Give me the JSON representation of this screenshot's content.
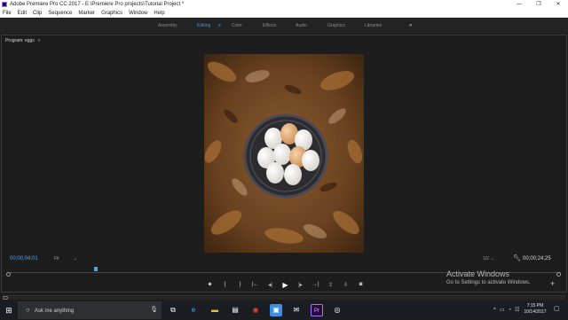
{
  "window": {
    "title": "Adobe Premiere Pro CC 2017 - E:\\Premiere Pro projects\\Tutorial Project *",
    "controls": [
      "—",
      "❐",
      "✕"
    ]
  },
  "menu": [
    "File",
    "Edit",
    "Clip",
    "Sequence",
    "Marker",
    "Graphics",
    "Window",
    "Help"
  ],
  "workspaces": [
    {
      "label": "Assembly",
      "active": false
    },
    {
      "label": "Editing",
      "active": true
    },
    {
      "label": "Color",
      "active": false
    },
    {
      "label": "Effects",
      "active": false
    },
    {
      "label": "Audio",
      "active": false
    },
    {
      "label": "Graphics",
      "active": false
    },
    {
      "label": "Libraries",
      "active": false
    }
  ],
  "workspace_menu_glyph": "≡",
  "more_glyph": "»",
  "program_monitor": {
    "tab_label": "Program: eggs",
    "tab_menu": "≡",
    "timecode_current": "00;00;04;01",
    "timecode_duration": "00;00;24;25",
    "zoom": "Fit",
    "resolution": "1/2",
    "caret": "⌄",
    "playhead_fraction": 0.16
  },
  "transport": {
    "marker": "⬥",
    "mark_in": "{",
    "mark_out": "}",
    "go_to_in": "|←",
    "step_back": "◂|",
    "play": "▶",
    "step_forward": "|▸",
    "go_to_out": "→|",
    "lift": "⇪",
    "extract": "⇩",
    "export_frame": "◙",
    "add": "+"
  },
  "activation": {
    "line1": "Activate Windows",
    "line2": "Go to Settings to activate Windows."
  },
  "taskbar": {
    "search_placeholder": "Ask me anything",
    "time": "7:15 PM",
    "date": "10/14/2017",
    "tray_glyphs": [
      "^",
      "▭",
      "◔",
      "☷"
    ],
    "icons": [
      {
        "name": "task-view-icon",
        "glyph": "⧉",
        "color": "#1a1d22"
      },
      {
        "name": "edge-icon",
        "glyph": "e",
        "color": "#1e6fd9"
      },
      {
        "name": "file-explorer-icon",
        "glyph": "▬",
        "color": "#e8b73b"
      },
      {
        "name": "store-icon",
        "glyph": "▤",
        "color": "#2d6fd1"
      },
      {
        "name": "chrome-icon",
        "glyph": "◉",
        "color": "#db4437"
      },
      {
        "name": "photos-icon",
        "glyph": "▣",
        "color": "#3a8ee6"
      },
      {
        "name": "mail-icon",
        "glyph": "✉",
        "color": "#2a6ad3"
      },
      {
        "name": "premiere-icon",
        "glyph": "Pr",
        "color": "#2a0a3a"
      },
      {
        "name": "media-icon",
        "glyph": "◎",
        "color": "#3a3d44"
      }
    ]
  },
  "colors": {
    "accent_blue": "#4f9ff0",
    "premiere_purple": "#9a7bff",
    "panel_bg": "#1d1d1d"
  }
}
